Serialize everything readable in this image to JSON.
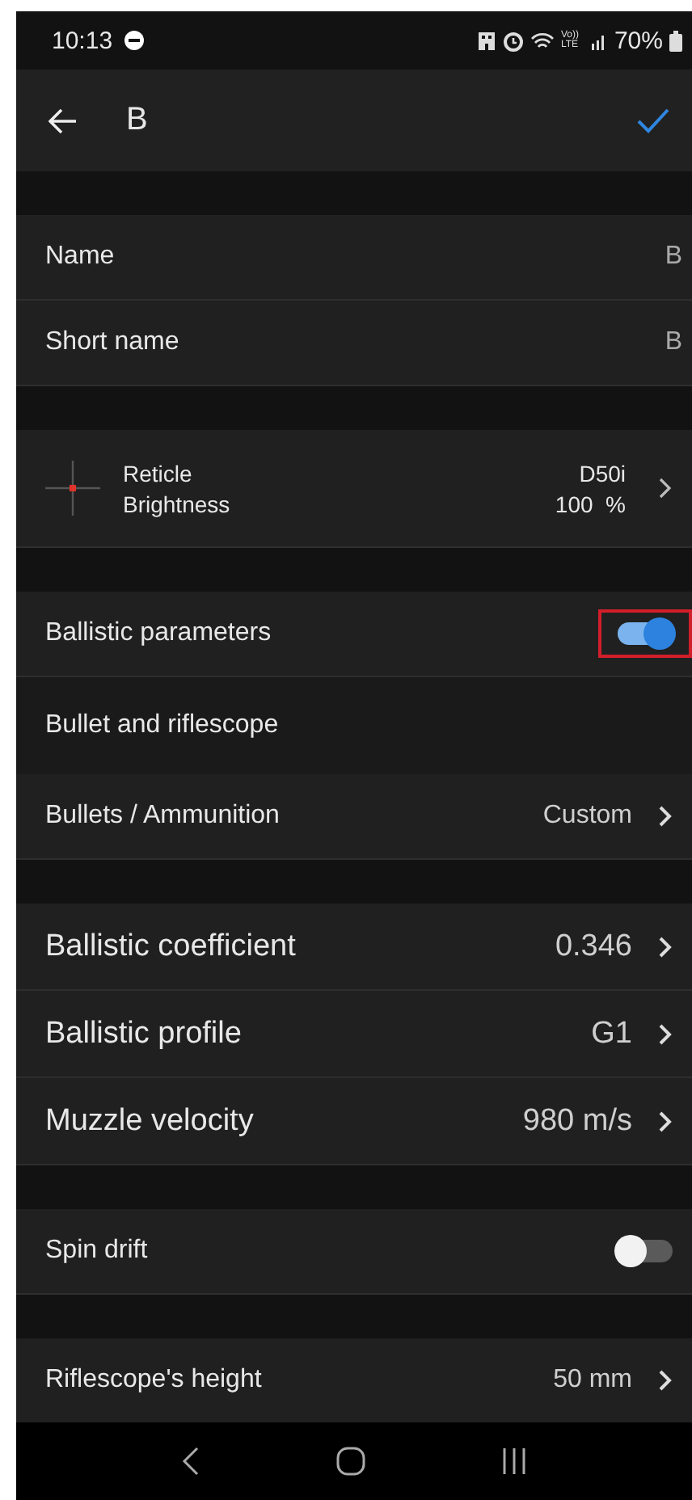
{
  "status_bar": {
    "time": "10:13",
    "network": "Vo)) LTE",
    "battery": "70%"
  },
  "toolbar": {
    "title": "B"
  },
  "sections": [
    {
      "rows": [
        {
          "kind": "value",
          "label": "Name",
          "value": "B"
        },
        {
          "kind": "value",
          "label": "Short name",
          "value": "B"
        }
      ]
    },
    {
      "rows": [
        {
          "kind": "reticle",
          "labels": [
            "Reticle",
            "Brightness"
          ],
          "values": [
            "D50i",
            "100  %"
          ]
        }
      ]
    },
    {
      "rows": [
        {
          "kind": "toggle",
          "label": "Ballistic parameters",
          "on": true,
          "highlighted": true
        },
        {
          "kind": "header",
          "label": "Bullet and riflescope"
        },
        {
          "kind": "nav",
          "label": "Bullets / Ammunition",
          "value": "Custom"
        }
      ]
    },
    {
      "rows": [
        {
          "kind": "nav",
          "label": "Ballistic coefficient",
          "value": "0.346"
        },
        {
          "kind": "nav",
          "label": "Ballistic profile",
          "value": "G1"
        },
        {
          "kind": "nav",
          "label": "Muzzle velocity",
          "value": "980 m/s"
        }
      ]
    },
    {
      "rows": [
        {
          "kind": "toggle",
          "label": "Spin drift",
          "on": false,
          "highlighted": false
        }
      ]
    },
    {
      "rows": [
        {
          "kind": "nav",
          "label": "Riflescope's height",
          "value": "50 mm"
        }
      ]
    }
  ]
}
